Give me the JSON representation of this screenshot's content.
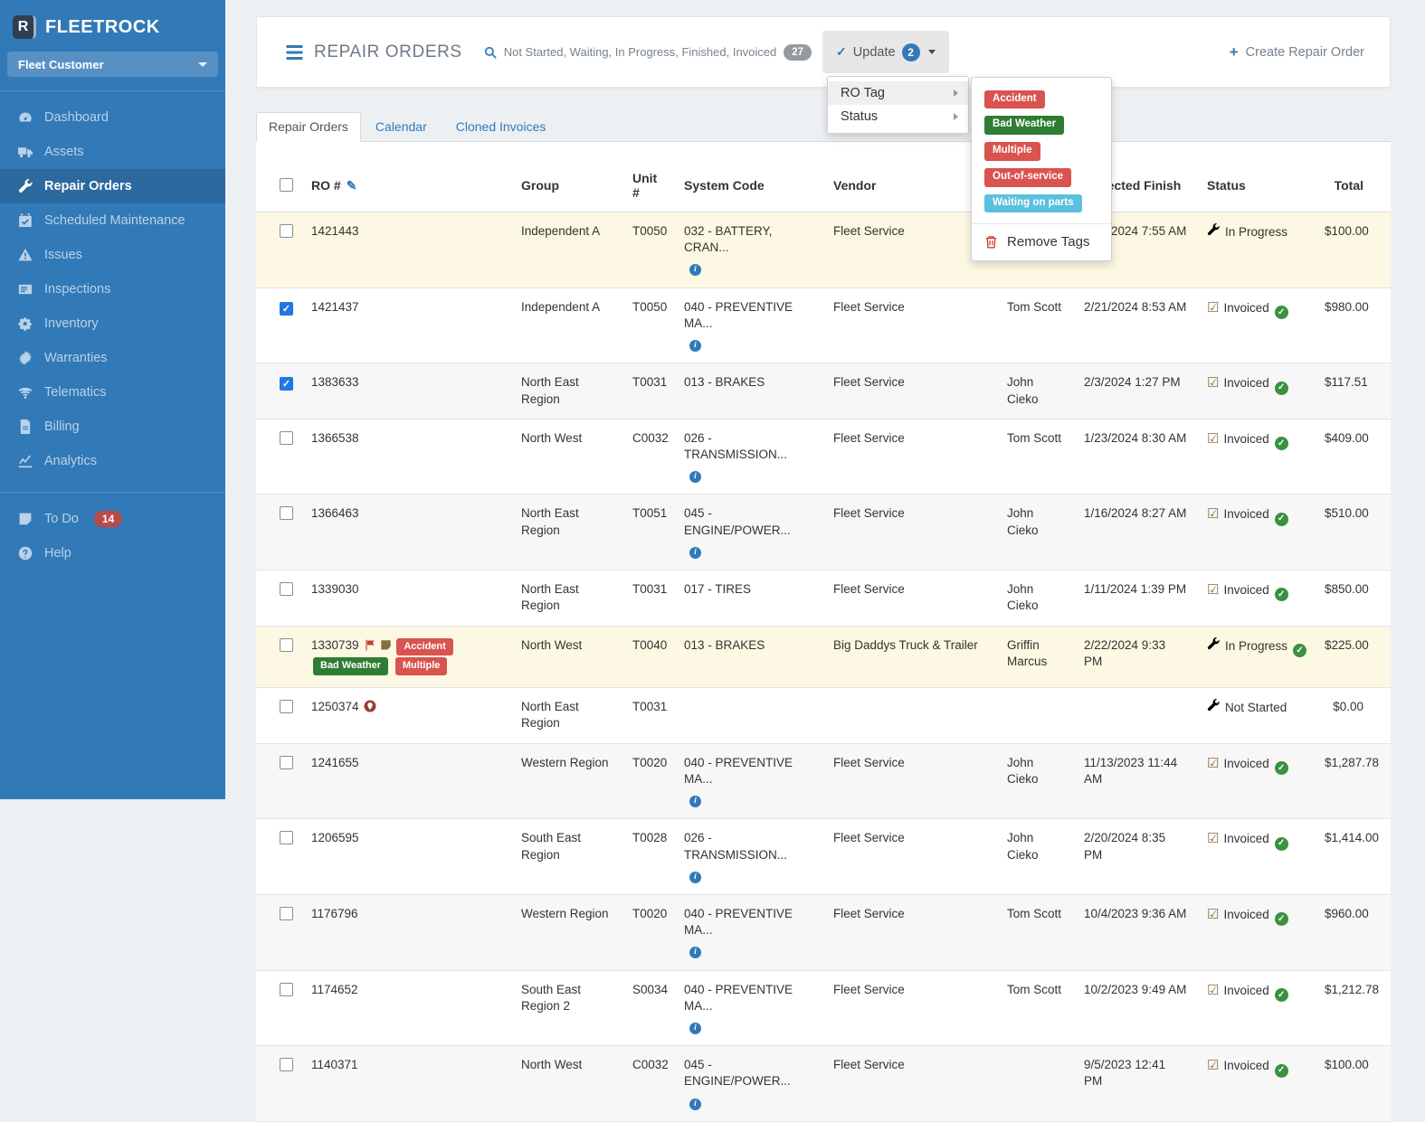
{
  "app": {
    "brand": "FLEETROCK",
    "brand_letter": "R",
    "customer_selector": "Fleet Customer"
  },
  "colors": {
    "sidebar": "#3279b7",
    "accent": "#3279b7",
    "danger_tag": "#d9534f",
    "green_tag": "#2e7d32",
    "info_tag": "#5bc0de",
    "warning_row": "#fcf8e3",
    "success_check": "#3a9140",
    "inprogress_icon": "#8a6d3b",
    "notstarted_icon": "#a94442",
    "todo_badge": "#b94a48"
  },
  "sidebar": {
    "items": [
      {
        "label": "Dashboard",
        "icon": "gauge",
        "active": false
      },
      {
        "label": "Assets",
        "icon": "truck",
        "active": false
      },
      {
        "label": "Repair Orders",
        "icon": "wrench",
        "active": true
      },
      {
        "label": "Scheduled Maintenance",
        "icon": "calendar",
        "active": false
      },
      {
        "label": "Issues",
        "icon": "warning",
        "active": false
      },
      {
        "label": "Inspections",
        "icon": "inspect",
        "active": false
      },
      {
        "label": "Inventory",
        "icon": "cogs",
        "active": false
      },
      {
        "label": "Warranties",
        "icon": "seal",
        "active": false
      },
      {
        "label": "Telematics",
        "icon": "wifi",
        "active": false
      },
      {
        "label": "Billing",
        "icon": "file",
        "active": false
      },
      {
        "label": "Analytics",
        "icon": "chart",
        "active": false
      }
    ],
    "footer_items": [
      {
        "label": "To Do",
        "icon": "note",
        "badge": "14"
      },
      {
        "label": "Help",
        "icon": "help",
        "badge": ""
      }
    ]
  },
  "header": {
    "title": "REPAIR ORDERS",
    "filter_text": "Not Started, Waiting, In Progress, Finished, Invoiced",
    "filter_count": "27",
    "update_label": "Update",
    "update_count": "2",
    "create_label": "Create Repair Order"
  },
  "dropdown": {
    "menu_items": [
      {
        "label": "RO Tag",
        "highlighted": true
      },
      {
        "label": "Status",
        "highlighted": false
      }
    ],
    "tags": [
      {
        "label": "Accident",
        "color": "#d9534f"
      },
      {
        "label": "Bad Weather",
        "color": "#2e7d32"
      },
      {
        "label": "Multiple",
        "color": "#d9534f"
      },
      {
        "label": "Out-of-service",
        "color": "#d9534f"
      },
      {
        "label": "Waiting on parts",
        "color": "#5bc0de"
      }
    ],
    "remove_label": "Remove Tags"
  },
  "tabs": [
    {
      "label": "Repair Orders",
      "active": true
    },
    {
      "label": "Calendar",
      "active": false
    },
    {
      "label": "Cloned Invoices",
      "active": false
    }
  ],
  "table": {
    "columns": [
      {
        "label": "RO #",
        "pencil": true
      },
      {
        "label": "Group",
        "pencil": false
      },
      {
        "label": "Unit #",
        "pencil": false
      },
      {
        "label": "System Code",
        "pencil": false
      },
      {
        "label": "Vendor",
        "pencil": false
      },
      {
        "label": "",
        "pencil": false
      },
      {
        "label": "Expected Finish",
        "pencil": false
      },
      {
        "label": "Status",
        "pencil": false
      },
      {
        "label": "Total",
        "pencil": false
      }
    ],
    "rows": [
      {
        "ro": "1421443",
        "checked": false,
        "highlight": true,
        "ro_icons": [],
        "tags": [],
        "group": "Independent A",
        "unit": "T0050",
        "system": "032 - BATTERY, CRAN...",
        "info": true,
        "vendor": "Fleet Service",
        "technician": "",
        "finish": "2/22/2024 7:55 AM",
        "status": {
          "label": "In Progress",
          "type": "in-progress",
          "verified": false
        },
        "total": "$100.00"
      },
      {
        "ro": "1421437",
        "checked": true,
        "highlight": false,
        "ro_icons": [],
        "tags": [],
        "group": "Independent A",
        "unit": "T0050",
        "system": "040 - PREVENTIVE MA...",
        "info": true,
        "vendor": "Fleet Service",
        "technician": "Tom Scott",
        "finish": "2/21/2024 8:53 AM",
        "status": {
          "label": "Invoiced",
          "type": "invoiced",
          "verified": true
        },
        "total": "$980.00"
      },
      {
        "ro": "1383633",
        "checked": true,
        "highlight": false,
        "ro_icons": [],
        "tags": [],
        "group": "North East Region",
        "unit": "T0031",
        "system": "013 - BRAKES",
        "info": false,
        "vendor": "Fleet Service",
        "technician": "John Cieko",
        "finish": "2/3/2024 1:27 PM",
        "status": {
          "label": "Invoiced",
          "type": "invoiced",
          "verified": true
        },
        "total": "$117.51"
      },
      {
        "ro": "1366538",
        "checked": false,
        "highlight": false,
        "ro_icons": [],
        "tags": [],
        "group": "North West",
        "unit": "C0032",
        "system": "026 - TRANSMISSION...",
        "info": true,
        "vendor": "Fleet Service",
        "technician": "Tom Scott",
        "finish": "1/23/2024 8:30 AM",
        "status": {
          "label": "Invoiced",
          "type": "invoiced",
          "verified": true
        },
        "total": "$409.00"
      },
      {
        "ro": "1366463",
        "checked": false,
        "highlight": false,
        "ro_icons": [],
        "tags": [],
        "group": "North East Region",
        "unit": "T0051",
        "system": "045 - ENGINE/POWER...",
        "info": true,
        "vendor": "Fleet Service",
        "technician": "John Cieko",
        "finish": "1/16/2024 8:27 AM",
        "status": {
          "label": "Invoiced",
          "type": "invoiced",
          "verified": true
        },
        "total": "$510.00"
      },
      {
        "ro": "1339030",
        "checked": false,
        "highlight": false,
        "ro_icons": [],
        "tags": [],
        "group": "North East Region",
        "unit": "T0031",
        "system": "017 - TIRES",
        "info": false,
        "vendor": "Fleet Service",
        "technician": "John Cieko",
        "finish": "1/11/2024 1:39 PM",
        "status": {
          "label": "Invoiced",
          "type": "invoiced",
          "verified": true
        },
        "total": "$850.00"
      },
      {
        "ro": "1330739",
        "checked": false,
        "highlight": true,
        "ro_icons": [
          "flag",
          "note"
        ],
        "tags": [
          {
            "label": "Accident",
            "color": "#d9534f"
          },
          {
            "label": "Bad Weather",
            "color": "#2e7d32"
          },
          {
            "label": "Multiple",
            "color": "#d9534f"
          }
        ],
        "group": "North West",
        "unit": "T0040",
        "system": "013 - BRAKES",
        "info": false,
        "vendor": "Big Daddys Truck & Trailer",
        "technician": "Griffin Marcus",
        "finish": "2/22/2024 9:33 PM",
        "status": {
          "label": "In Progress",
          "type": "in-progress",
          "verified": true
        },
        "total": "$225.00"
      },
      {
        "ro": "1250374",
        "checked": false,
        "highlight": false,
        "ro_icons": [
          "marker"
        ],
        "tags": [],
        "group": "North East Region",
        "unit": "T0031",
        "system": "",
        "info": false,
        "vendor": "",
        "technician": "",
        "finish": "",
        "status": {
          "label": "Not Started",
          "type": "not-started",
          "verified": false
        },
        "total": "$0.00"
      },
      {
        "ro": "1241655",
        "checked": false,
        "highlight": false,
        "ro_icons": [],
        "tags": [],
        "group": "Western Region",
        "unit": "T0020",
        "system": "040 - PREVENTIVE MA...",
        "info": true,
        "vendor": "Fleet Service",
        "technician": "John Cieko",
        "finish": "11/13/2023 11:44 AM",
        "status": {
          "label": "Invoiced",
          "type": "invoiced",
          "verified": true
        },
        "total": "$1,287.78"
      },
      {
        "ro": "1206595",
        "checked": false,
        "highlight": false,
        "ro_icons": [],
        "tags": [],
        "group": "South East Region",
        "unit": "T0028",
        "system": "026 - TRANSMISSION...",
        "info": true,
        "vendor": "Fleet Service",
        "technician": "John Cieko",
        "finish": "2/20/2024 8:35 PM",
        "status": {
          "label": "Invoiced",
          "type": "invoiced",
          "verified": true
        },
        "total": "$1,414.00"
      },
      {
        "ro": "1176796",
        "checked": false,
        "highlight": false,
        "ro_icons": [],
        "tags": [],
        "group": "Western Region",
        "unit": "T0020",
        "system": "040 - PREVENTIVE MA...",
        "info": true,
        "vendor": "Fleet Service",
        "technician": "Tom Scott",
        "finish": "10/4/2023 9:36 AM",
        "status": {
          "label": "Invoiced",
          "type": "invoiced",
          "verified": true
        },
        "total": "$960.00"
      },
      {
        "ro": "1174652",
        "checked": false,
        "highlight": false,
        "ro_icons": [],
        "tags": [],
        "group": "South East Region 2",
        "unit": "S0034",
        "system": "040 - PREVENTIVE MA...",
        "info": true,
        "vendor": "Fleet Service",
        "technician": "Tom Scott",
        "finish": "10/2/2023 9:49 AM",
        "status": {
          "label": "Invoiced",
          "type": "invoiced",
          "verified": true
        },
        "total": "$1,212.78"
      },
      {
        "ro": "1140371",
        "checked": false,
        "highlight": false,
        "ro_icons": [],
        "tags": [],
        "group": "North West",
        "unit": "C0032",
        "system": "045 - ENGINE/POWER...",
        "info": true,
        "vendor": "Fleet Service",
        "technician": "",
        "finish": "9/5/2023 12:41 PM",
        "status": {
          "label": "Invoiced",
          "type": "invoiced",
          "verified": true
        },
        "total": "$100.00"
      }
    ]
  }
}
